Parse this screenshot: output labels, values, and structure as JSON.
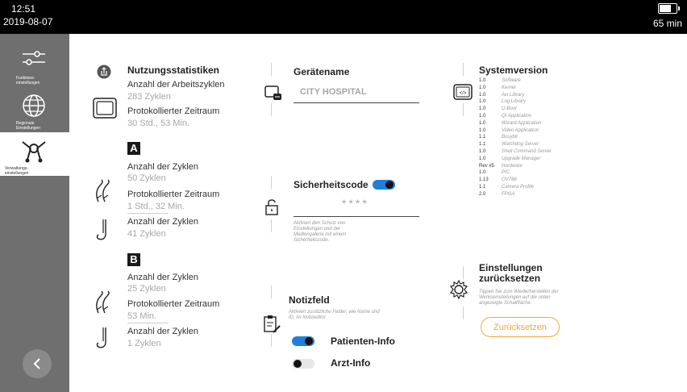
{
  "status_bar": {
    "time": "12:51",
    "date": "2019-08-07",
    "battery_remaining": "65 min",
    "battery_level": 0.75
  },
  "sidebar": {
    "items": [
      {
        "label": "Funktions-\neinstellungen",
        "icon": "sliders-icon",
        "active": false
      },
      {
        "label": "Regionale\nEinstellungen",
        "icon": "globe-icon",
        "active": false
      },
      {
        "label": "Verwaltungs-\neinstellungen",
        "icon": "tools-icon",
        "active": true
      }
    ],
    "back_icon": "chevron-left-icon"
  },
  "usage": {
    "title": "Nutzungsstatistiken",
    "total_cycles_label": "Anzahl der Arbeitszyklen",
    "total_cycles_value": "283 Zyklen",
    "total_time_label": "Protokollierter Zeitraum",
    "total_time_value": "30 Std., 53 Min.",
    "port_a": {
      "letter": "A",
      "cycles_label": "Anzahl der Zyklen",
      "cycles_value": "50 Zyklen",
      "time_label": "Protokollierter Zeitraum",
      "time_value": "1 Std., 32 Min.",
      "cycles2_label": "Anzahl der Zyklen",
      "cycles2_value": "41 Zyklen"
    },
    "port_b": {
      "letter": "B",
      "cycles_label": "Anzahl der Zyklen",
      "cycles_value": "25 Zyklen",
      "time_label": "Protokollierter Zeitraum",
      "time_value": "53 Min.",
      "cycles2_label": "Anzahl der Zyklen",
      "cycles2_value": "1 Zyklen"
    }
  },
  "device": {
    "title": "Gerätename",
    "value": "CITY HOSPITAL"
  },
  "security": {
    "title": "Sicherheitscode",
    "enabled": true,
    "code_mask": "****",
    "hint": "Aktiviert den Schutz von Einstellungen und der Mediengalerie mit einem Sicherheitscode."
  },
  "notes": {
    "title": "Notizfeld",
    "hint": "Aktiviert zusätzliche Felder, wie Name und ID, im Notizeditor.",
    "patient_label": "Patienten-Info",
    "patient_on": true,
    "doctor_label": "Arzt-Info",
    "doctor_on": false
  },
  "system": {
    "title": "Systemversion",
    "rows": [
      {
        "version": "1.0",
        "name": "Software"
      },
      {
        "version": "1.0",
        "name": "Kernel"
      },
      {
        "version": "1.0",
        "name": "Avi Library"
      },
      {
        "version": "1.0",
        "name": "Log Library"
      },
      {
        "version": "1.0",
        "name": "U-Boot"
      },
      {
        "version": "1.0",
        "name": "QI Application"
      },
      {
        "version": "1.0",
        "name": "Wizard Application"
      },
      {
        "version": "1.0",
        "name": "Video Application"
      },
      {
        "version": "1.1",
        "name": "Busybit"
      },
      {
        "version": "1.1",
        "name": "Watchdog Server"
      },
      {
        "version": "1.0",
        "name": "Shell Command Server"
      },
      {
        "version": "1.0",
        "name": "Upgrade Manager"
      },
      {
        "version": "Rev #5",
        "name": "Hardware"
      },
      {
        "version": "1.0",
        "name": "PIC"
      },
      {
        "version": "1.13",
        "name": "OV788"
      },
      {
        "version": "1.1",
        "name": "Camera Profile"
      },
      {
        "version": "2.0",
        "name": "FPGA"
      }
    ]
  },
  "reset": {
    "title": "Einstellungen\nzurücksetzen",
    "hint": "Tippen Sie zum Wiederherstellen der Werkseinstellungen auf die unten angezeigte Schaltfläche.",
    "button_label": "Zurücksetzen",
    "accent": "#f2a83a"
  },
  "colors": {
    "toggle_on": "#1f7fd9",
    "sidebar_bg": "#6f6f6f"
  }
}
